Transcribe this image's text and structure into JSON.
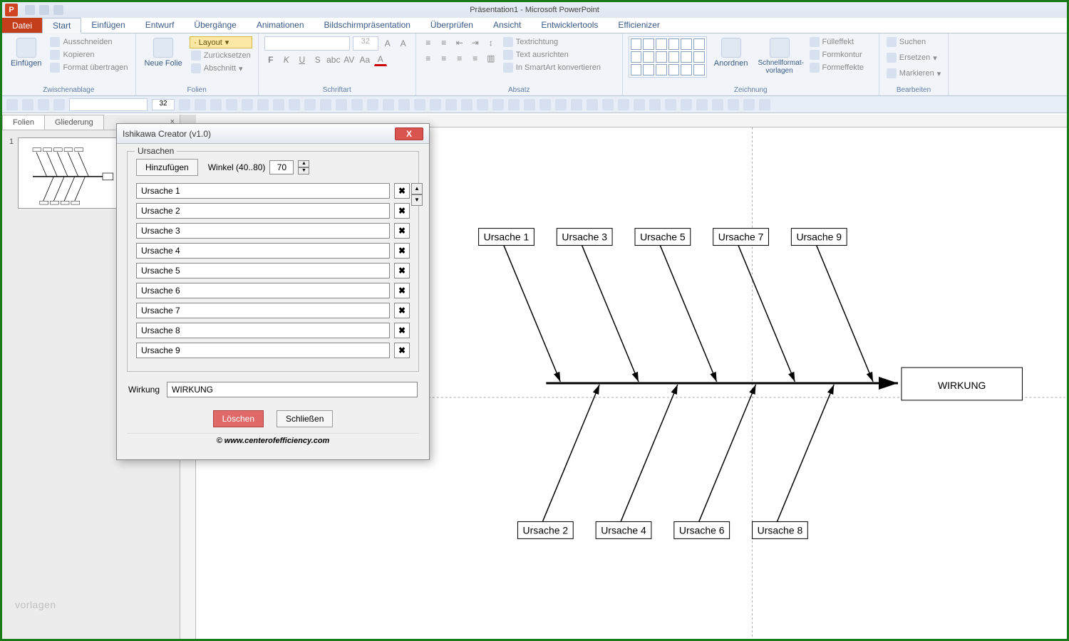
{
  "app": {
    "title": "Präsentation1 - Microsoft PowerPoint",
    "icon_label": "P"
  },
  "ribbon": {
    "file": "Datei",
    "tabs": [
      "Start",
      "Einfügen",
      "Entwurf",
      "Übergänge",
      "Animationen",
      "Bildschirmpräsentation",
      "Überprüfen",
      "Ansicht",
      "Entwicklertools",
      "Efficienizer"
    ],
    "active_tab": "Start",
    "groups": {
      "clipboard": {
        "label": "Zwischenablage",
        "paste": "Einfügen",
        "cut": "Ausschneiden",
        "copy": "Kopieren",
        "format_painter": "Format übertragen"
      },
      "slides": {
        "label": "Folien",
        "new_slide": "Neue Folie",
        "layout": "Layout",
        "reset": "Zurücksetzen",
        "section": "Abschnitt"
      },
      "font": {
        "label": "Schriftart",
        "size": "32"
      },
      "paragraph": {
        "label": "Absatz",
        "text_direction": "Textrichtung",
        "align_text": "Text ausrichten",
        "smartart": "In SmartArt konvertieren"
      },
      "drawing": {
        "label": "Zeichnung",
        "arrange": "Anordnen",
        "quick_styles": "Schnellformat-vorlagen",
        "shape_fill": "Fülleffekt",
        "shape_outline": "Formkontur",
        "shape_effects": "Formeffekte"
      },
      "editing": {
        "label": "Bearbeiten",
        "find": "Suchen",
        "replace": "Ersetzen",
        "select": "Markieren"
      }
    }
  },
  "qat2_fontsize": "32",
  "slidepanel": {
    "tab_slides": "Folien",
    "tab_outline": "Gliederung",
    "slide_num": "1"
  },
  "dialog": {
    "title": "Ishikawa Creator (v1.0)",
    "fieldset_label": "Ursachen",
    "add_btn": "Hinzufügen",
    "angle_label": "Winkel (40..80)",
    "angle_value": "70",
    "causes": [
      "Ursache 1",
      "Ursache 2",
      "Ursache 3",
      "Ursache 4",
      "Ursache 5",
      "Ursache 6",
      "Ursache 7",
      "Ursache 8",
      "Ursache 9"
    ],
    "effect_label": "Wirkung",
    "effect_value": "WIRKUNG",
    "delete_btn": "Löschen",
    "close_btn": "Schließen",
    "copyright": "© www.centerofefficiency.com"
  },
  "diagram": {
    "effect": "WIRKUNG",
    "top_causes": [
      "Ursache 1",
      "Ursache 3",
      "Ursache 5",
      "Ursache 7",
      "Ursache 9"
    ],
    "bottom_causes": [
      "Ursache 2",
      "Ursache 4",
      "Ursache 6",
      "Ursache 8"
    ]
  },
  "watermark": "vorlagen"
}
